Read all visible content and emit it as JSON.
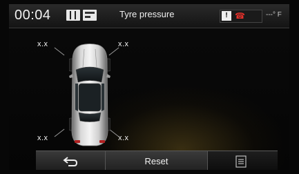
{
  "status_bar": {
    "time": "00:04",
    "title": "Tyre pressure",
    "message_icon_text": "!",
    "temperature": "---° F",
    "icons": [
      "map-book-icon",
      "radio-icon",
      "message-icon",
      "phone-call-icon"
    ]
  },
  "pressures": {
    "front_left": "x.x",
    "front_right": "x.x",
    "rear_left": "x.x",
    "rear_right": "x.x"
  },
  "bottom_bar": {
    "back_icon": "back-arrow-icon",
    "reset_label": "Reset",
    "menu_icon": "list-menu-icon"
  },
  "colors": {
    "call_icon": "#e0302a",
    "glow": "#967828"
  }
}
